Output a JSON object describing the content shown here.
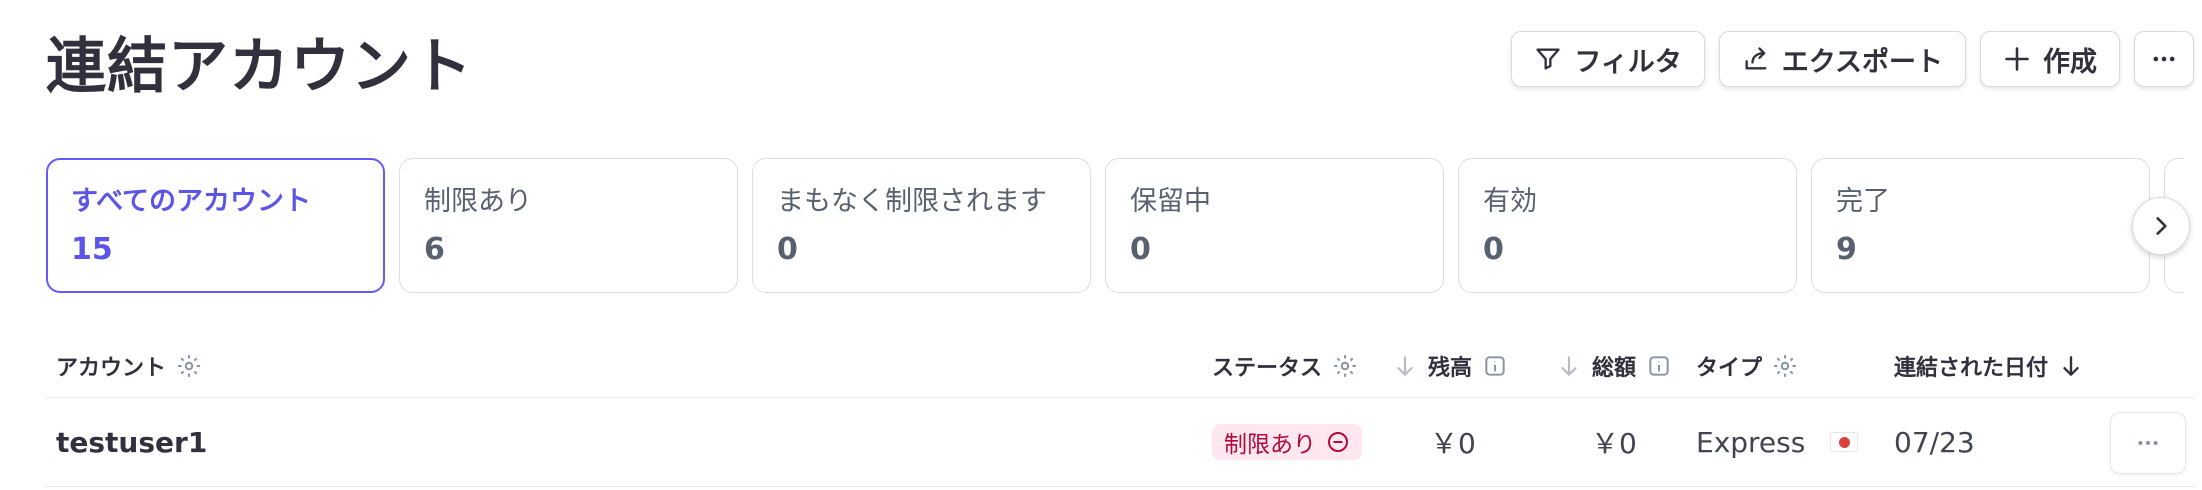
{
  "page": {
    "title": "連結アカウント"
  },
  "toolbar": {
    "filter_label": "フィルタ",
    "export_label": "エクスポート",
    "create_label": "作成"
  },
  "tabs": [
    {
      "label": "すべてのアカウント",
      "count": "15",
      "active": true
    },
    {
      "label": "制限あり",
      "count": "6"
    },
    {
      "label": "まもなく制限されます",
      "count": "0"
    },
    {
      "label": "保留中",
      "count": "0"
    },
    {
      "label": "有効",
      "count": "0"
    },
    {
      "label": "完了",
      "count": "9"
    }
  ],
  "table": {
    "columns": {
      "account": "アカウント",
      "status": "ステータス",
      "balance": "残高",
      "total": "総額",
      "type": "タイプ",
      "connected_date": "連結された日付"
    },
    "rows": [
      {
        "account": "testuser1",
        "status": "制限あり",
        "balance": "￥0",
        "total": "￥0",
        "type": "Express",
        "country_flag": "japan-flag",
        "connected_date": "07/23"
      }
    ]
  },
  "colors": {
    "accent": "#635bff",
    "status_restricted_bg": "#ffe7ef",
    "status_restricted_text": "#b3093c"
  }
}
